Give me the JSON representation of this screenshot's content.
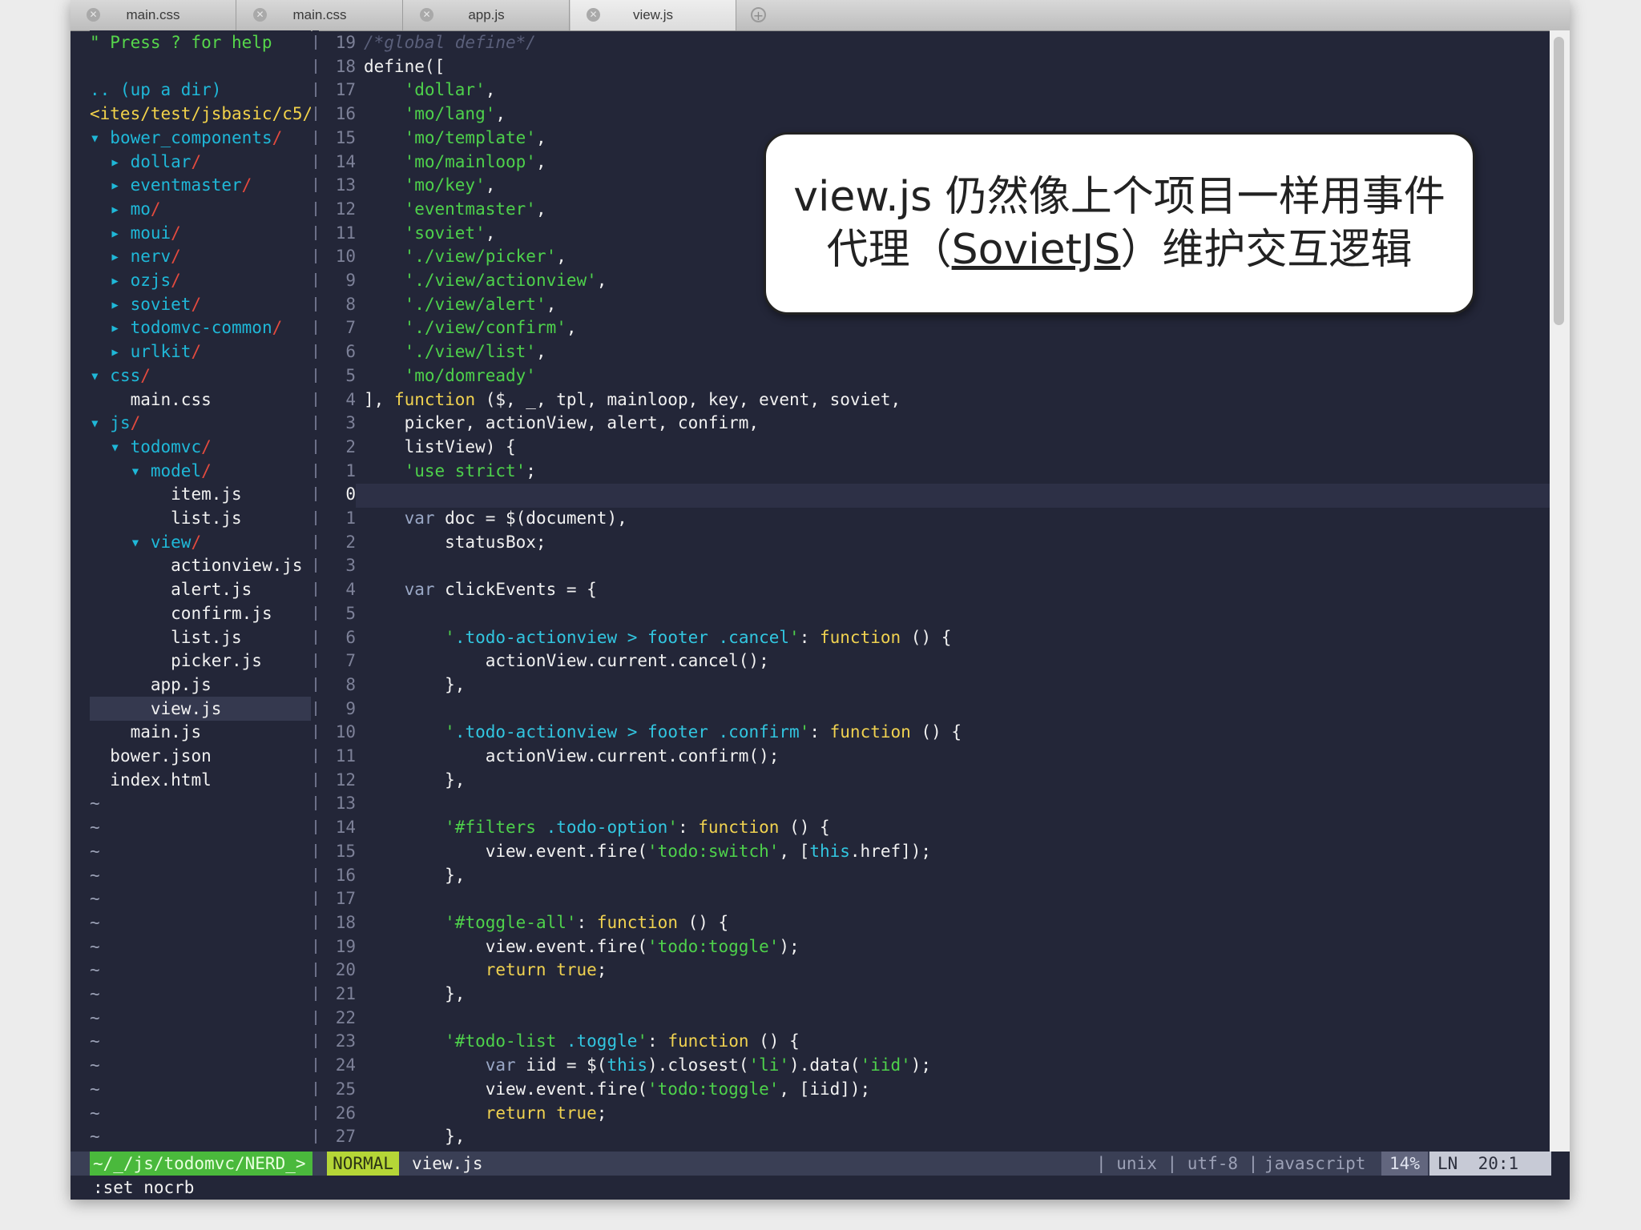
{
  "tabs": [
    {
      "label": "main.css",
      "active": false
    },
    {
      "label": "main.css",
      "active": false
    },
    {
      "label": "app.js",
      "active": false
    },
    {
      "label": "view.js",
      "active": true
    }
  ],
  "icons": {
    "tab_close": "close-icon",
    "tab_add": "plus-icon"
  },
  "tree": {
    "help": "\" Press ? for help",
    "updir": ".. (up a dir)",
    "cwd": "<ites/test/jsbasic/c5/",
    "items": [
      {
        "name": "bower_components",
        "type": "dir",
        "open": true,
        "depth": 0
      },
      {
        "name": "dollar",
        "type": "dir",
        "open": false,
        "depth": 1
      },
      {
        "name": "eventmaster",
        "type": "dir",
        "open": false,
        "depth": 1
      },
      {
        "name": "mo",
        "type": "dir",
        "open": false,
        "depth": 1
      },
      {
        "name": "moui",
        "type": "dir",
        "open": false,
        "depth": 1
      },
      {
        "name": "nerv",
        "type": "dir",
        "open": false,
        "depth": 1
      },
      {
        "name": "ozjs",
        "type": "dir",
        "open": false,
        "depth": 1
      },
      {
        "name": "soviet",
        "type": "dir",
        "open": false,
        "depth": 1
      },
      {
        "name": "todomvc-common",
        "type": "dir",
        "open": false,
        "depth": 1
      },
      {
        "name": "urlkit",
        "type": "dir",
        "open": false,
        "depth": 1
      },
      {
        "name": "css",
        "type": "dir",
        "open": true,
        "depth": 0
      },
      {
        "name": "main.css",
        "type": "file",
        "depth": 1
      },
      {
        "name": "js",
        "type": "dir",
        "open": true,
        "depth": 0
      },
      {
        "name": "todomvc",
        "type": "dir",
        "open": true,
        "depth": 1
      },
      {
        "name": "model",
        "type": "dir",
        "open": true,
        "depth": 2
      },
      {
        "name": "item.js",
        "type": "file",
        "depth": 3
      },
      {
        "name": "list.js",
        "type": "file",
        "depth": 3
      },
      {
        "name": "view",
        "type": "dir",
        "open": true,
        "depth": 2
      },
      {
        "name": "actionview.js",
        "type": "file",
        "depth": 3
      },
      {
        "name": "alert.js",
        "type": "file",
        "depth": 3
      },
      {
        "name": "confirm.js",
        "type": "file",
        "depth": 3
      },
      {
        "name": "list.js",
        "type": "file",
        "depth": 3
      },
      {
        "name": "picker.js",
        "type": "file",
        "depth": 3
      },
      {
        "name": "app.js",
        "type": "file",
        "depth": 2
      },
      {
        "name": "view.js",
        "type": "file",
        "depth": 2,
        "selected": true
      },
      {
        "name": "main.js",
        "type": "file",
        "depth": 1
      },
      {
        "name": "bower.json",
        "type": "file",
        "depth": 0
      },
      {
        "name": "index.html",
        "type": "file",
        "depth": 0
      }
    ],
    "tilde": "~"
  },
  "editor": {
    "current_line_index": 19,
    "line_numbers": [
      "19",
      "18",
      "17",
      "16",
      "15",
      "14",
      "13",
      "12",
      "11",
      "10",
      "9",
      "8",
      "7",
      "6",
      "5",
      "4",
      "3",
      "2",
      "1",
      "0",
      "1",
      "2",
      "3",
      "4",
      "5",
      "6",
      "7",
      "8",
      "9",
      "10",
      "11",
      "12",
      "13",
      "14",
      "15",
      "16",
      "17",
      "18",
      "19",
      "20",
      "21",
      "22",
      "23",
      "24",
      "25",
      "26",
      "27"
    ],
    "lines": [
      [
        [
          "c",
          "/*global define*/"
        ]
      ],
      [
        [
          "",
          "define(["
        ]
      ],
      [
        [
          "",
          "    "
        ],
        [
          "s",
          "'dollar'"
        ],
        [
          "",
          ","
        ]
      ],
      [
        [
          "",
          "    "
        ],
        [
          "s",
          "'mo/lang'"
        ],
        [
          "",
          ","
        ]
      ],
      [
        [
          "",
          "    "
        ],
        [
          "s",
          "'mo/template'"
        ],
        [
          "",
          ","
        ]
      ],
      [
        [
          "",
          "    "
        ],
        [
          "s",
          "'mo/mainloop'"
        ],
        [
          "",
          ","
        ]
      ],
      [
        [
          "",
          "    "
        ],
        [
          "s",
          "'mo/key'"
        ],
        [
          "",
          ","
        ]
      ],
      [
        [
          "",
          "    "
        ],
        [
          "s",
          "'eventmaster'"
        ],
        [
          "",
          ","
        ]
      ],
      [
        [
          "",
          "    "
        ],
        [
          "s",
          "'soviet'"
        ],
        [
          "",
          ","
        ]
      ],
      [
        [
          "",
          "    "
        ],
        [
          "s",
          "'./view/picker'"
        ],
        [
          "",
          ","
        ]
      ],
      [
        [
          "",
          "    "
        ],
        [
          "s",
          "'./view/actionview'"
        ],
        [
          "",
          ","
        ]
      ],
      [
        [
          "",
          "    "
        ],
        [
          "s",
          "'./view/alert'"
        ],
        [
          "",
          ","
        ]
      ],
      [
        [
          "",
          "    "
        ],
        [
          "s",
          "'./view/confirm'"
        ],
        [
          "",
          ","
        ]
      ],
      [
        [
          "",
          "    "
        ],
        [
          "s",
          "'./view/list'"
        ],
        [
          "",
          ","
        ]
      ],
      [
        [
          "",
          "    "
        ],
        [
          "s",
          "'mo/domready'"
        ]
      ],
      [
        [
          "",
          "], "
        ],
        [
          "k",
          "function"
        ],
        [
          "",
          " ($, _, tpl, mainloop, key, event, soviet,"
        ]
      ],
      [
        [
          "",
          "    picker, actionView, alert, confirm,"
        ]
      ],
      [
        [
          "",
          "    listView) {"
        ]
      ],
      [
        [
          "",
          "    "
        ],
        [
          "s",
          "'use strict'"
        ],
        [
          "",
          ";"
        ]
      ],
      [
        [
          "",
          ""
        ]
      ],
      [
        [
          "",
          "    "
        ],
        [
          "v",
          "var"
        ],
        [
          "",
          " doc = $(document),"
        ]
      ],
      [
        [
          "",
          "        statusBox;"
        ]
      ],
      [
        [
          "",
          ""
        ]
      ],
      [
        [
          "",
          "    "
        ],
        [
          "v",
          "var"
        ],
        [
          "",
          " clickEvents = {"
        ]
      ],
      [
        [
          "",
          ""
        ]
      ],
      [
        [
          "",
          "        "
        ],
        [
          "s",
          "'"
        ],
        [
          "sel",
          ".todo-actionview > footer .cancel"
        ],
        [
          "s",
          "'"
        ],
        [
          "",
          ": "
        ],
        [
          "k",
          "function"
        ],
        [
          "",
          " () {"
        ]
      ],
      [
        [
          "",
          "            actionView.current.cancel();"
        ]
      ],
      [
        [
          "",
          "        },"
        ]
      ],
      [
        [
          "",
          ""
        ]
      ],
      [
        [
          "",
          "        "
        ],
        [
          "s",
          "'"
        ],
        [
          "sel",
          ".todo-actionview > footer .confirm"
        ],
        [
          "s",
          "'"
        ],
        [
          "",
          ": "
        ],
        [
          "k",
          "function"
        ],
        [
          "",
          " () {"
        ]
      ],
      [
        [
          "",
          "            actionView.current.confirm();"
        ]
      ],
      [
        [
          "",
          "        },"
        ]
      ],
      [
        [
          "",
          ""
        ]
      ],
      [
        [
          "",
          "        "
        ],
        [
          "s",
          "'#filters "
        ],
        [
          "sel",
          ".todo-option"
        ],
        [
          "s",
          "'"
        ],
        [
          "",
          ": "
        ],
        [
          "k",
          "function"
        ],
        [
          "",
          " () {"
        ]
      ],
      [
        [
          "",
          "            view.event.fire("
        ],
        [
          "s",
          "'todo:switch'"
        ],
        [
          "",
          ", ["
        ],
        [
          "sel",
          "this"
        ],
        [
          "",
          ".href]);"
        ]
      ],
      [
        [
          "",
          "        },"
        ]
      ],
      [
        [
          "",
          ""
        ]
      ],
      [
        [
          "",
          "        "
        ],
        [
          "s",
          "'#toggle-all'"
        ],
        [
          "",
          ": "
        ],
        [
          "k",
          "function"
        ],
        [
          "",
          " () {"
        ]
      ],
      [
        [
          "",
          "            view.event.fire("
        ],
        [
          "s",
          "'todo:toggle'"
        ],
        [
          "",
          ");"
        ]
      ],
      [
        [
          "",
          "            "
        ],
        [
          "k",
          "return true"
        ],
        [
          "",
          ";"
        ]
      ],
      [
        [
          "",
          "        },"
        ]
      ],
      [
        [
          "",
          ""
        ]
      ],
      [
        [
          "",
          "        "
        ],
        [
          "s",
          "'#todo-list "
        ],
        [
          "sel",
          ".toggle"
        ],
        [
          "s",
          "'"
        ],
        [
          "",
          ": "
        ],
        [
          "k",
          "function"
        ],
        [
          "",
          " () {"
        ]
      ],
      [
        [
          "",
          "            "
        ],
        [
          "v",
          "var"
        ],
        [
          "",
          " iid = $("
        ],
        [
          "sel",
          "this"
        ],
        [
          "",
          ").closest("
        ],
        [
          "s",
          "'li'"
        ],
        [
          "",
          ").data("
        ],
        [
          "s",
          "'iid'"
        ],
        [
          "",
          ");"
        ]
      ],
      [
        [
          "",
          "            view.event.fire("
        ],
        [
          "s",
          "'todo:toggle'"
        ],
        [
          "",
          ", [iid]);"
        ]
      ],
      [
        [
          "",
          "            "
        ],
        [
          "k",
          "return true"
        ],
        [
          "",
          ";"
        ]
      ],
      [
        [
          "",
          "        },"
        ]
      ]
    ]
  },
  "status": {
    "path": "~/_/js/todomvc/NERD_>",
    "mode": "NORMAL",
    "file": "view.js",
    "fileformat": "| unix | utf-8 |",
    "filetype": "javascript",
    "percent": "14%",
    "position": "LN  20:1"
  },
  "cmdline": ":set nocrb",
  "callout": {
    "line1": "view.js 仍然像上个项目一样用事件",
    "line2_pre": "代理（",
    "line2_link": "SovietJS",
    "line2_post": "）维护交互逻辑"
  },
  "colors": {
    "background": "#232638",
    "string": "#4ed14b",
    "keyword": "#f0d250",
    "directory": "#1fb8d8",
    "mode_badge": "#b5d637",
    "path_badge": "#4ab93c"
  }
}
